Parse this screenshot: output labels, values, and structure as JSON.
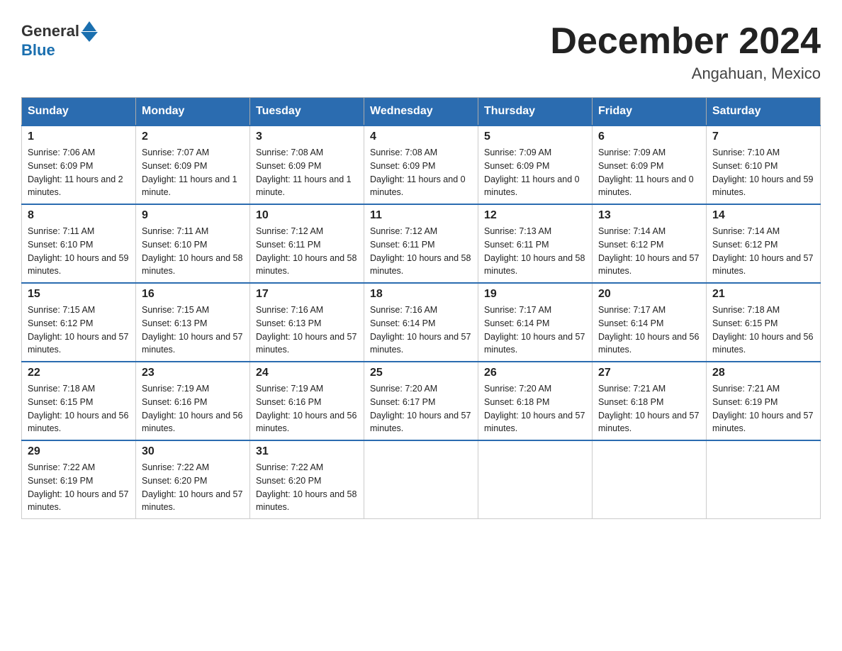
{
  "header": {
    "logo_text_general": "General",
    "logo_text_blue": "Blue",
    "month_title": "December 2024",
    "location": "Angahuan, Mexico"
  },
  "days_of_week": [
    "Sunday",
    "Monday",
    "Tuesday",
    "Wednesday",
    "Thursday",
    "Friday",
    "Saturday"
  ],
  "weeks": [
    [
      {
        "day": "1",
        "sunrise": "7:06 AM",
        "sunset": "6:09 PM",
        "daylight": "11 hours and 2 minutes."
      },
      {
        "day": "2",
        "sunrise": "7:07 AM",
        "sunset": "6:09 PM",
        "daylight": "11 hours and 1 minute."
      },
      {
        "day": "3",
        "sunrise": "7:08 AM",
        "sunset": "6:09 PM",
        "daylight": "11 hours and 1 minute."
      },
      {
        "day": "4",
        "sunrise": "7:08 AM",
        "sunset": "6:09 PM",
        "daylight": "11 hours and 0 minutes."
      },
      {
        "day": "5",
        "sunrise": "7:09 AM",
        "sunset": "6:09 PM",
        "daylight": "11 hours and 0 minutes."
      },
      {
        "day": "6",
        "sunrise": "7:09 AM",
        "sunset": "6:09 PM",
        "daylight": "11 hours and 0 minutes."
      },
      {
        "day": "7",
        "sunrise": "7:10 AM",
        "sunset": "6:10 PM",
        "daylight": "10 hours and 59 minutes."
      }
    ],
    [
      {
        "day": "8",
        "sunrise": "7:11 AM",
        "sunset": "6:10 PM",
        "daylight": "10 hours and 59 minutes."
      },
      {
        "day": "9",
        "sunrise": "7:11 AM",
        "sunset": "6:10 PM",
        "daylight": "10 hours and 58 minutes."
      },
      {
        "day": "10",
        "sunrise": "7:12 AM",
        "sunset": "6:11 PM",
        "daylight": "10 hours and 58 minutes."
      },
      {
        "day": "11",
        "sunrise": "7:12 AM",
        "sunset": "6:11 PM",
        "daylight": "10 hours and 58 minutes."
      },
      {
        "day": "12",
        "sunrise": "7:13 AM",
        "sunset": "6:11 PM",
        "daylight": "10 hours and 58 minutes."
      },
      {
        "day": "13",
        "sunrise": "7:14 AM",
        "sunset": "6:12 PM",
        "daylight": "10 hours and 57 minutes."
      },
      {
        "day": "14",
        "sunrise": "7:14 AM",
        "sunset": "6:12 PM",
        "daylight": "10 hours and 57 minutes."
      }
    ],
    [
      {
        "day": "15",
        "sunrise": "7:15 AM",
        "sunset": "6:12 PM",
        "daylight": "10 hours and 57 minutes."
      },
      {
        "day": "16",
        "sunrise": "7:15 AM",
        "sunset": "6:13 PM",
        "daylight": "10 hours and 57 minutes."
      },
      {
        "day": "17",
        "sunrise": "7:16 AM",
        "sunset": "6:13 PM",
        "daylight": "10 hours and 57 minutes."
      },
      {
        "day": "18",
        "sunrise": "7:16 AM",
        "sunset": "6:14 PM",
        "daylight": "10 hours and 57 minutes."
      },
      {
        "day": "19",
        "sunrise": "7:17 AM",
        "sunset": "6:14 PM",
        "daylight": "10 hours and 57 minutes."
      },
      {
        "day": "20",
        "sunrise": "7:17 AM",
        "sunset": "6:14 PM",
        "daylight": "10 hours and 56 minutes."
      },
      {
        "day": "21",
        "sunrise": "7:18 AM",
        "sunset": "6:15 PM",
        "daylight": "10 hours and 56 minutes."
      }
    ],
    [
      {
        "day": "22",
        "sunrise": "7:18 AM",
        "sunset": "6:15 PM",
        "daylight": "10 hours and 56 minutes."
      },
      {
        "day": "23",
        "sunrise": "7:19 AM",
        "sunset": "6:16 PM",
        "daylight": "10 hours and 56 minutes."
      },
      {
        "day": "24",
        "sunrise": "7:19 AM",
        "sunset": "6:16 PM",
        "daylight": "10 hours and 56 minutes."
      },
      {
        "day": "25",
        "sunrise": "7:20 AM",
        "sunset": "6:17 PM",
        "daylight": "10 hours and 57 minutes."
      },
      {
        "day": "26",
        "sunrise": "7:20 AM",
        "sunset": "6:18 PM",
        "daylight": "10 hours and 57 minutes."
      },
      {
        "day": "27",
        "sunrise": "7:21 AM",
        "sunset": "6:18 PM",
        "daylight": "10 hours and 57 minutes."
      },
      {
        "day": "28",
        "sunrise": "7:21 AM",
        "sunset": "6:19 PM",
        "daylight": "10 hours and 57 minutes."
      }
    ],
    [
      {
        "day": "29",
        "sunrise": "7:22 AM",
        "sunset": "6:19 PM",
        "daylight": "10 hours and 57 minutes."
      },
      {
        "day": "30",
        "sunrise": "7:22 AM",
        "sunset": "6:20 PM",
        "daylight": "10 hours and 57 minutes."
      },
      {
        "day": "31",
        "sunrise": "7:22 AM",
        "sunset": "6:20 PM",
        "daylight": "10 hours and 58 minutes."
      },
      null,
      null,
      null,
      null
    ]
  ]
}
